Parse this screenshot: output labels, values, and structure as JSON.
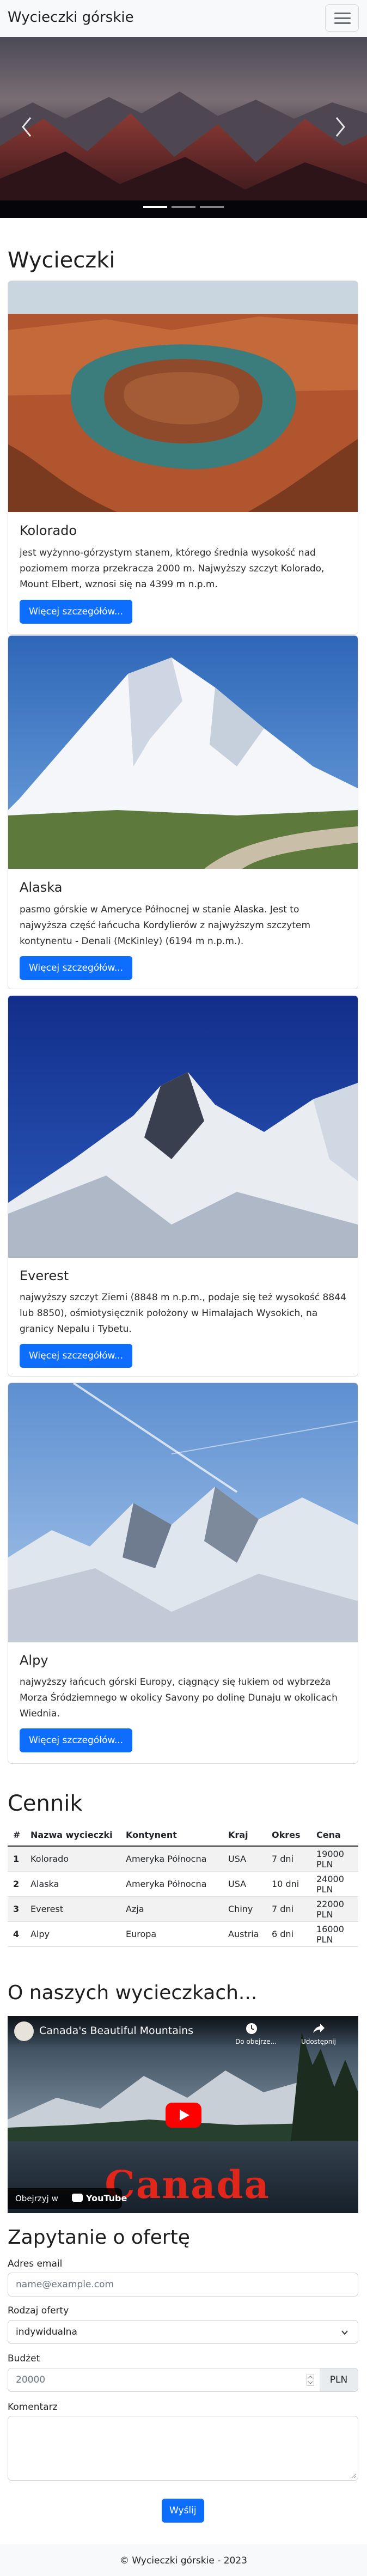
{
  "navbar": {
    "brand": "Wycieczki górskie",
    "toggler_icon": "hamburger-icon"
  },
  "carousel": {
    "slides": 3,
    "active": 0,
    "prev_icon": "chevron-left-icon",
    "next_icon": "chevron-right-icon"
  },
  "trips": {
    "heading": "Wycieczki",
    "cards": [
      {
        "title": "Kolorado",
        "text": "jest wyżynno-górzystym stanem, którego średnia wysokość nad poziomem morza przekracza 2000 m. Najwyższy szczyt Kolorado, Mount Elbert, wznosi się na 4399 m n.p.m.",
        "button": "Więcej szczegółów..."
      },
      {
        "title": "Alaska",
        "text": "pasmo górskie w Ameryce Północnej w stanie Alaska. Jest to najwyższa część łańcucha Kordylierów z najwyższym szczytem kontynentu - Denali (McKinley) (6194 m n.p.m.).",
        "button": "Więcej szczegółów..."
      },
      {
        "title": "Everest",
        "text": "najwyższy szczyt Ziemi (8848 m n.p.m., podaje się też wysokość 8844 lub 8850), ośmiotysięcznik położony w Himalajach Wysokich, na granicy Nepalu i Tybetu.",
        "button": "Więcej szczegółów..."
      },
      {
        "title": "Alpy",
        "text": "najwyższy łańcuch górski Europy, ciągnący się łukiem od wybrzeża Morza Śródziemnego w okolicy Savony po dolinę Dunaju w okolicach Wiednia.",
        "button": "Więcej szczegółów..."
      }
    ]
  },
  "pricing": {
    "heading": "Cennik",
    "columns": [
      "#",
      "Nazwa wycieczki",
      "Kontynent",
      "Kraj",
      "Okres",
      "Cena"
    ],
    "rows": [
      [
        "1",
        "Kolorado",
        "Ameryka Północna",
        "USA",
        "7 dni",
        "19000 PLN"
      ],
      [
        "2",
        "Alaska",
        "Ameryka Północna",
        "USA",
        "10 dni",
        "24000 PLN"
      ],
      [
        "3",
        "Everest",
        "Azja",
        "Chiny",
        "7 dni",
        "22000 PLN"
      ],
      [
        "4",
        "Alpy",
        "Europa",
        "Austria",
        "6 dni",
        "16000 PLN"
      ]
    ]
  },
  "about": {
    "heading": "O naszych wycieczkach...",
    "video": {
      "title": "Canada's Beautiful Mountains",
      "watch_later": "Do obejrze...",
      "share": "Udostępnij",
      "watch_on": "Obejrzyj w",
      "youtube": "YouTube",
      "overlay_text": "Canada"
    }
  },
  "inquiry": {
    "heading": "Zapytanie o ofertę",
    "email_label": "Adres email",
    "email_placeholder": "name@example.com",
    "type_label": "Rodzaj oferty",
    "type_value": "indywidualna",
    "budget_label": "Budżet",
    "budget_placeholder": "20000",
    "budget_unit": "PLN",
    "comment_label": "Komentarz",
    "submit": "Wyślij"
  },
  "footer": {
    "text": "© Wycieczki górskie - 2023"
  },
  "colors": {
    "primary": "#0d6efd",
    "navbar": "#f8f9fa",
    "youtube_red": "#ff0000"
  }
}
